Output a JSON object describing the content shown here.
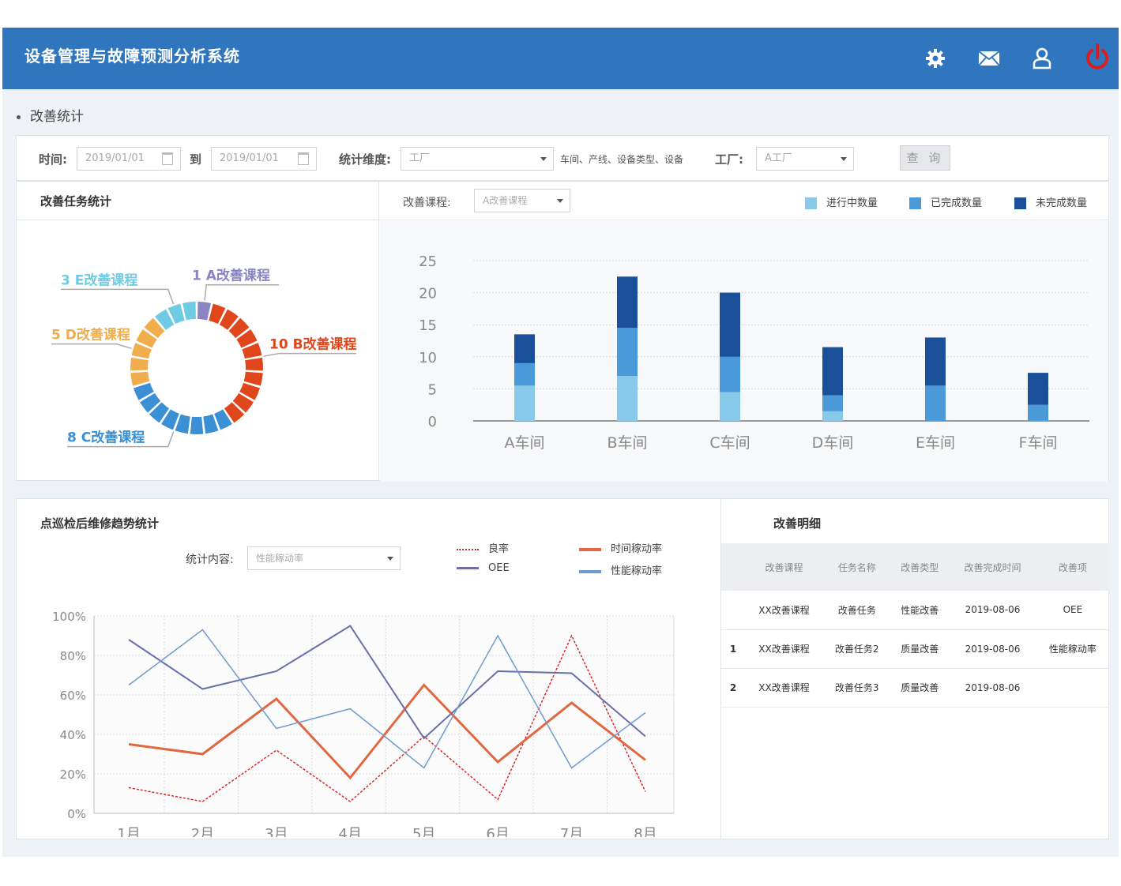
{
  "app": {
    "title": "设备管理与故障预测分析系统",
    "icons": [
      "gear-icon",
      "mail-icon",
      "user-icon",
      "power-icon"
    ]
  },
  "breadcrumb": "改善统计",
  "filters": {
    "time_label": "时间:",
    "date_from": "2019/01/01",
    "to_label": "到",
    "date_to": "2019/01/01",
    "dimension_label": "统计维度:",
    "dimension_value": "工厂",
    "dimension_hint": "车间、产线、设备类型、设备",
    "factory_label": "工厂:",
    "factory_value": "A工厂",
    "query_button": "查 询"
  },
  "task_stats": {
    "title": "改善任务统计",
    "segments": [
      {
        "label": "1 A改善课程",
        "count": 1,
        "color": "#8a84c2"
      },
      {
        "label": "10 B改善课程",
        "count": 10,
        "color": "#e0461b"
      },
      {
        "label": "8 C改善课程",
        "count": 8,
        "color": "#3b8fd4"
      },
      {
        "label": "5 D改善课程",
        "count": 5,
        "color": "#f0ad4e"
      },
      {
        "label": "3 E改善课程",
        "count": 3,
        "color": "#6ecbe3"
      }
    ]
  },
  "bar_panel": {
    "course_label": "改善课程:",
    "course_value": "A改善课程",
    "legend": [
      {
        "name": "进行中数量",
        "color": "#88c9ea"
      },
      {
        "name": "已完成数量",
        "color": "#4a9ad9"
      },
      {
        "name": "未完成数量",
        "color": "#1a4f9a"
      }
    ]
  },
  "trend_panel": {
    "title": "点巡检后维修趋势统计",
    "content_label": "统计内容:",
    "content_value": "性能稼动率",
    "legend": [
      {
        "name": "良率",
        "color": "#d9292a",
        "dash": true
      },
      {
        "name": "时间稼动率",
        "color": "#e06840",
        "dash": false
      },
      {
        "name": "OEE",
        "color": "#6a6fa8",
        "dash": false
      },
      {
        "name": "性能稼动率",
        "color": "#6e9bd0",
        "dash": false
      }
    ]
  },
  "detail_panel": {
    "title": "改善明细",
    "columns": [
      "改善课程",
      "任务名称",
      "改善类型",
      "改善完成时间",
      "改善项"
    ],
    "rows": [
      {
        "idx": "",
        "cells": [
          "XX改善课程",
          "改善任务",
          "性能改善",
          "2019-08-06",
          "OEE"
        ]
      },
      {
        "idx": "1",
        "cells": [
          "XX改善课程",
          "改善任务2",
          "质量改善",
          "2019-08-06",
          "性能稼动率"
        ]
      },
      {
        "idx": "2",
        "cells": [
          "XX改善课程",
          "改善任务3",
          "质量改善",
          "2019-08-06",
          ""
        ]
      }
    ]
  },
  "chart_data": [
    {
      "type": "bar",
      "stacked": true,
      "categories": [
        "A车间",
        "B车间",
        "C车间",
        "D车间",
        "E车间",
        "F车间"
      ],
      "ylim": [
        0,
        25
      ],
      "yticks": [
        "25",
        "20",
        "15",
        "10",
        "5",
        "0"
      ],
      "grid": true,
      "series": [
        {
          "name": "进行中数量",
          "values": [
            5.5,
            7,
            4.5,
            1.5,
            0,
            0
          ]
        },
        {
          "name": "已完成数量",
          "values": [
            3.5,
            7.5,
            5.5,
            2.5,
            5.5,
            2.5
          ]
        },
        {
          "name": "未完成数量",
          "values": [
            4.5,
            8,
            10,
            7.5,
            7.5,
            5
          ]
        }
      ]
    },
    {
      "type": "line",
      "x": [
        "1月",
        "2月",
        "3月",
        "4月",
        "5月",
        "6月",
        "7月",
        "8月"
      ],
      "yticks": [
        "100%",
        "80%",
        "60%",
        "40%",
        "20%",
        "0%"
      ],
      "ylim": [
        0,
        100
      ],
      "grid": true,
      "series": [
        {
          "name": "良率",
          "values": [
            13,
            6,
            32,
            6,
            39,
            7,
            90,
            11
          ]
        },
        {
          "name": "时间稼动率",
          "values": [
            35,
            30,
            58,
            18,
            65,
            26,
            56,
            27
          ]
        },
        {
          "name": "OEE",
          "values": [
            88,
            63,
            72,
            95,
            38,
            72,
            71,
            39
          ]
        },
        {
          "name": "性能稼动率",
          "values": [
            65,
            93,
            43,
            53,
            23,
            90,
            23,
            51
          ]
        }
      ]
    }
  ]
}
